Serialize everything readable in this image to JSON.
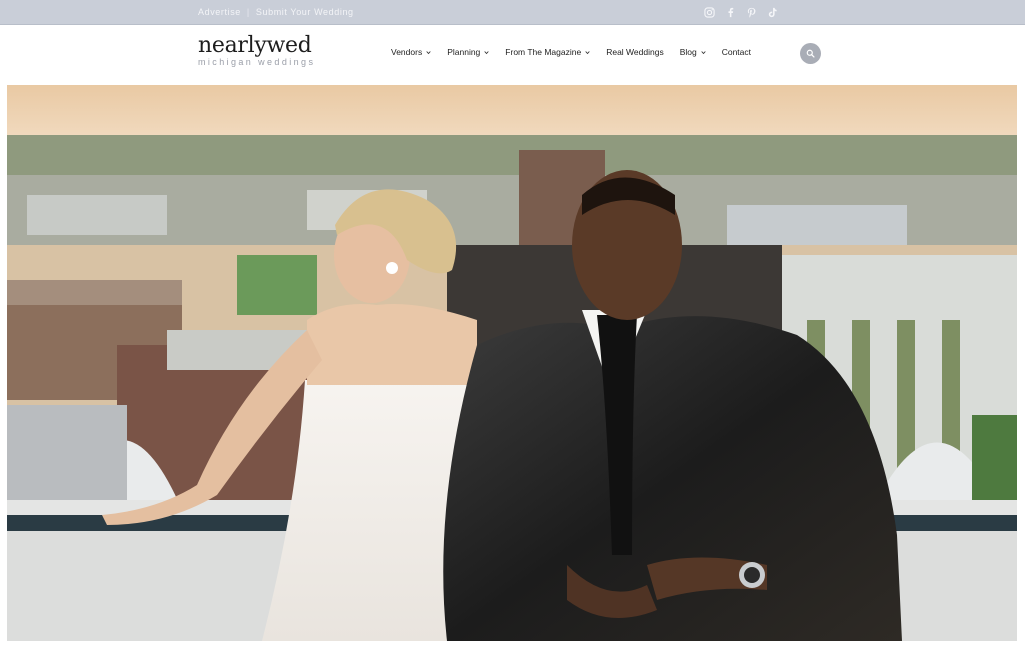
{
  "topbar": {
    "links": [
      "Advertise",
      "Submit Your Wedding"
    ],
    "social_icons": [
      "instagram-icon",
      "facebook-icon",
      "pinterest-icon",
      "tiktok-icon"
    ]
  },
  "header": {
    "logo_main": "nearlywed",
    "logo_sub": "michigan weddings",
    "nav": [
      {
        "label": "Vendors",
        "dropdown": true
      },
      {
        "label": "Planning",
        "dropdown": true
      },
      {
        "label": "From The Magazine",
        "dropdown": true
      },
      {
        "label": "Real Weddings",
        "dropdown": false
      },
      {
        "label": "Blog",
        "dropdown": true
      },
      {
        "label": "Contact",
        "dropdown": false
      }
    ],
    "search_icon": "search-icon"
  },
  "hero": {
    "image": "wedding-couple-rooftop-photo"
  },
  "colors": {
    "topbar_bg": "#c9ced8",
    "search_button_bg": "#a9adb6",
    "text_dark": "#1f1f1f"
  }
}
